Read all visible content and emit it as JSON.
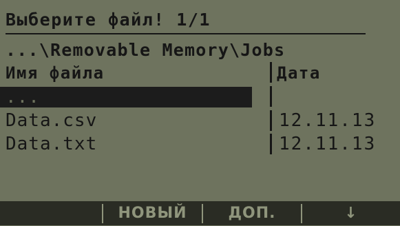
{
  "title": "Выберите файл! 1/1",
  "path": "...\\Removable Memory\\Jobs",
  "columns": {
    "name": "Имя файла",
    "date": "Дата"
  },
  "rows": [
    {
      "name": "...",
      "date": "",
      "selected": true
    },
    {
      "name": "Data.csv",
      "date": "12.11.13",
      "selected": false
    },
    {
      "name": "Data.txt",
      "date": "12.11.13",
      "selected": false
    }
  ],
  "softkeys": [
    "",
    "НОВЫЙ",
    "ДОП.",
    "",
    "↓"
  ],
  "colors": {
    "screen_bg": "#6e735e",
    "text": "#161616",
    "footer_bg": "#2a2c24",
    "footer_text": "#8f957c"
  }
}
